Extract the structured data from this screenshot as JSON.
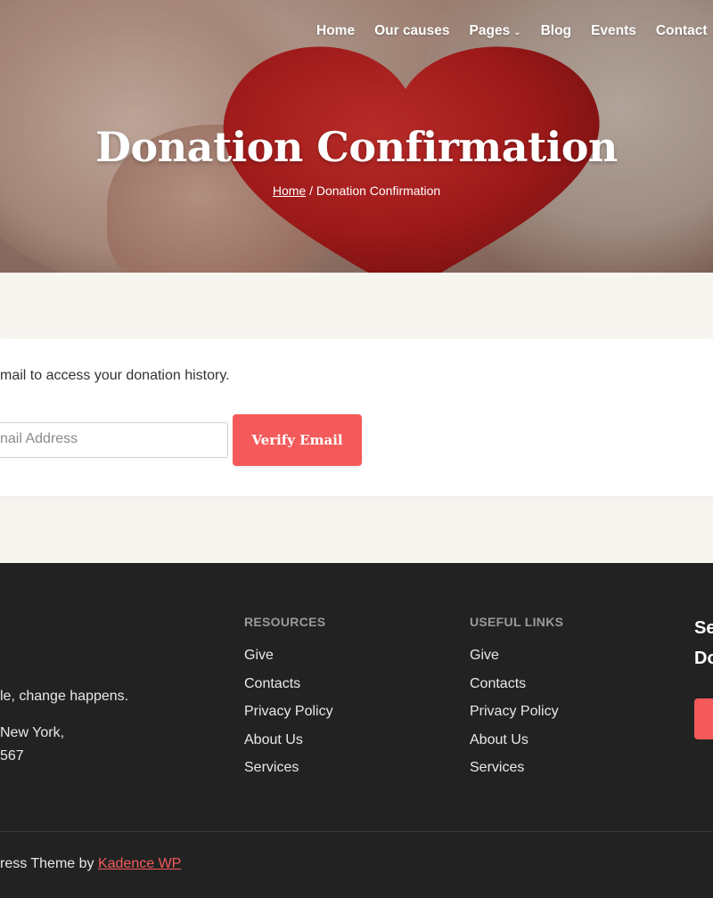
{
  "nav": {
    "items": [
      {
        "label": "Home"
      },
      {
        "label": "Our causes"
      },
      {
        "label": "Pages",
        "dropdown": true
      },
      {
        "label": "Blog"
      },
      {
        "label": "Events"
      },
      {
        "label": "Contact"
      }
    ],
    "dropdown_icon": "chevron-down-icon"
  },
  "hero": {
    "title": "Donation Confirmation",
    "breadcrumb": {
      "home": "Home",
      "separator": " / ",
      "current": "Donation Confirmation"
    },
    "image_subject": "red knitted heart held in hand"
  },
  "verify": {
    "intro": "mail to access your donation history.",
    "email_placeholder": "nail Address",
    "button_label": "Verify Email"
  },
  "footer": {
    "about": {
      "tagline": "le, change happens.",
      "address_line1": "New York,",
      "address_line2": "567"
    },
    "resources": {
      "title": "RESOURCES",
      "links": [
        "Give",
        "Contacts",
        "Privacy Policy",
        "About Us",
        "Services"
      ]
    },
    "useful_links": {
      "title": "USEFUL LINKS",
      "links": [
        "Give",
        "Contacts",
        "Privacy Policy",
        "About Us",
        "Services"
      ]
    },
    "right_column": {
      "heading_line1": "Se",
      "heading_line2": "Do"
    },
    "credit": {
      "text": "ress Theme by ",
      "link": "Kadence WP"
    }
  },
  "colors": {
    "accent": "#f45a5a",
    "footer_bg": "#222222",
    "page_bg": "#f7f5f0",
    "card_bg": "#ffffff"
  }
}
